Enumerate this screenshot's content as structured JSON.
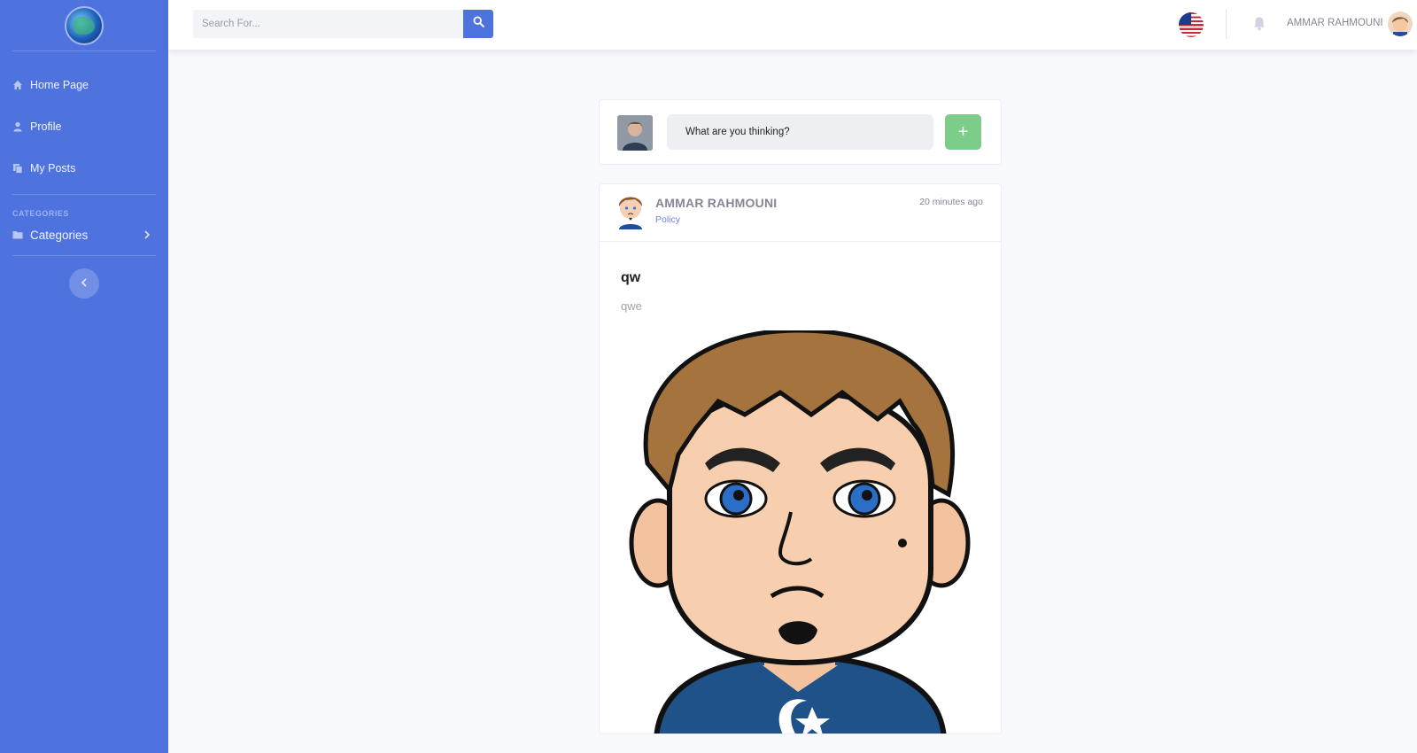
{
  "search": {
    "placeholder": "Search For..."
  },
  "sidebar": {
    "items": [
      {
        "label": "Home Page",
        "icon": "home-icon"
      },
      {
        "label": "Profile",
        "icon": "user-icon"
      },
      {
        "label": "My Posts",
        "icon": "copy-icon"
      }
    ],
    "heading": "CATEGORIES",
    "categories_label": "Categories"
  },
  "topbar": {
    "user_name": "AMMAR RAHMOUNI",
    "language_flag": "us-flag-icon"
  },
  "composer": {
    "prompt": "What are you thinking?",
    "add_label": "+"
  },
  "post": {
    "author": "AMMAR RAHMOUNI",
    "category": "Policy",
    "time": "20 minutes ago",
    "title": "qw",
    "body": "qwe"
  },
  "colors": {
    "sidebar": "#4e73df",
    "accent": "#4e73df",
    "add_button": "#7ccd89",
    "background": "#f8f9fc"
  }
}
